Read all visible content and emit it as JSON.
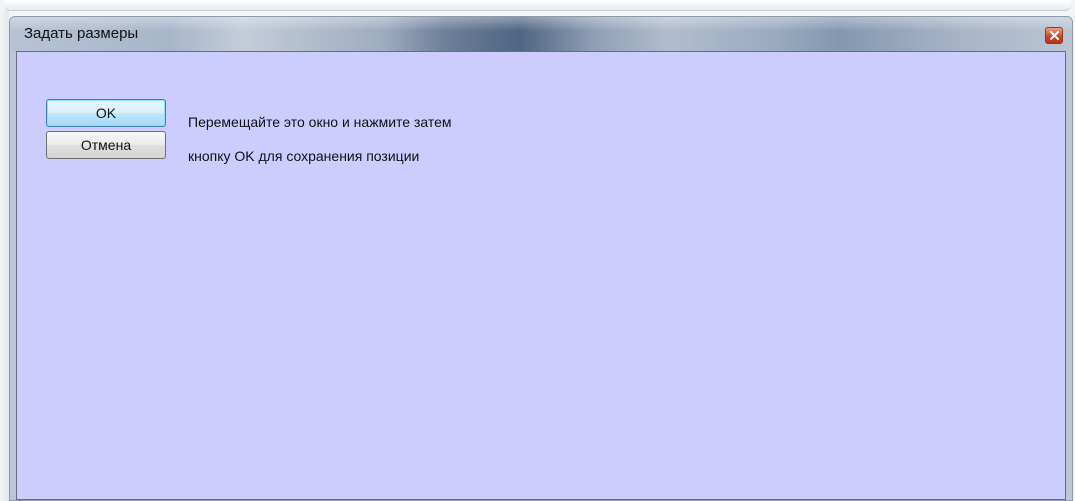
{
  "window": {
    "title": "Задать размеры",
    "close_icon": "close-icon",
    "client_background": "#ccccff",
    "titlebar_accent": "#4f6582"
  },
  "buttons": {
    "ok_label": "OK",
    "cancel_label": "Отмена"
  },
  "instruction": {
    "line1": "Перемещайте это окно и нажмите затем",
    "line2": "кнопку OK для сохранения позиции"
  }
}
